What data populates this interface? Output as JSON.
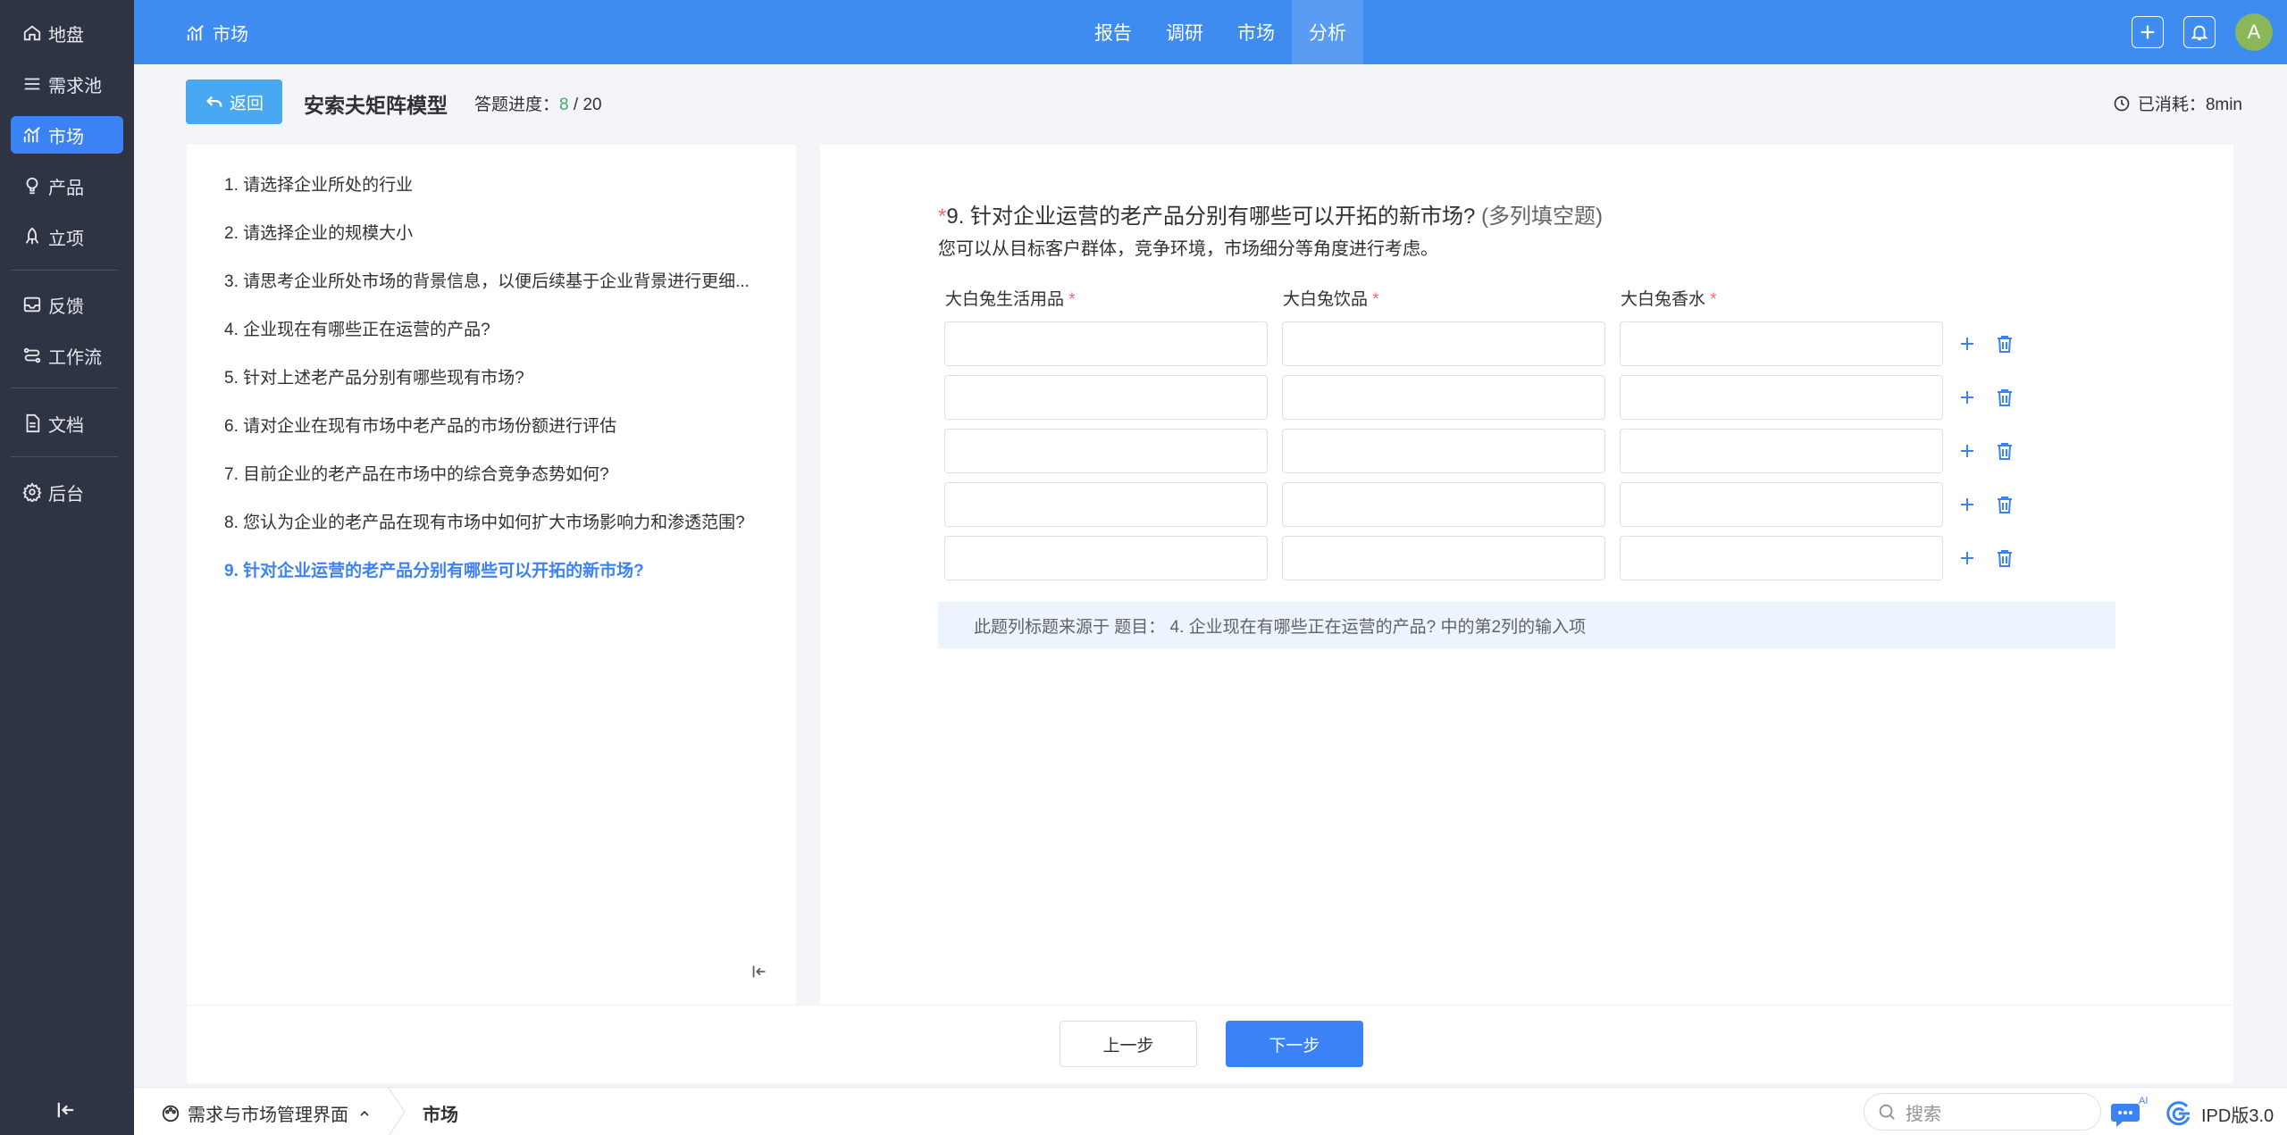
{
  "sidebar": {
    "items": [
      {
        "label": "地盘",
        "icon": "home-icon"
      },
      {
        "label": "需求池",
        "icon": "list-icon"
      },
      {
        "label": "市场",
        "icon": "chart-icon",
        "active": true
      },
      {
        "label": "产品",
        "icon": "bulb-icon"
      },
      {
        "label": "立项",
        "icon": "rocket-icon"
      },
      {
        "label": "反馈",
        "icon": "inbox-icon"
      },
      {
        "label": "工作流",
        "icon": "workflow-icon"
      },
      {
        "label": "文档",
        "icon": "document-icon"
      },
      {
        "label": "后台",
        "icon": "gear-icon"
      }
    ]
  },
  "header": {
    "title": "市场",
    "nav": [
      "报告",
      "调研",
      "市场",
      "分析"
    ],
    "active_nav": "分析",
    "avatar": "A"
  },
  "topbar": {
    "back_label": "返回",
    "title": "安索夫矩阵模型",
    "progress_label": "答题进度：",
    "progress_current": "8",
    "progress_sep": " / ",
    "progress_total": "20",
    "elapsed": "已消耗：8min"
  },
  "questions": [
    "1. 请选择企业所处的行业",
    "2. 请选择企业的规模大小",
    "3. 请思考企业所处市场的背景信息，以便后续基于企业背景进行更细...",
    "4. 企业现在有哪些正在运营的产品?",
    "5. 针对上述老产品分别有哪些现有市场?",
    "6. 请对企业在现有市场中老产品的市场份额进行评估",
    "7. 目前企业的老产品在市场中的综合竞争态势如何?",
    "8. 您认为企业的老产品在现有市场中如何扩大市场影响力和渗透范围?",
    "9. 针对企业运营的老产品分别有哪些可以开拓的新市场?"
  ],
  "current_question": {
    "required_mark": "*",
    "title": "9. 针对企业运营的老产品分别有哪些可以开拓的新市场?",
    "type": "(多列填空题)",
    "description": "您可以从目标客户群体，竞争环境，市场细分等角度进行考虑。",
    "columns": [
      "大白兔生活用品",
      "大白兔饮品",
      "大白兔香水"
    ],
    "rows": 5,
    "hint": "此题列标题来源于 题目： 4. 企业现在有哪些正在运营的产品?  中的第2列的输入项"
  },
  "footer": {
    "prev": "上一步",
    "next": "下一步"
  },
  "bottombar": {
    "crumb1": "需求与市场管理界面",
    "crumb2": "市场",
    "search_placeholder": "搜索",
    "brand": "IPD版3.0"
  },
  "colors": {
    "primary": "#3b82f6",
    "header": "#3f8cf0",
    "sidebar": "#2f3444",
    "required": "#f56c6c",
    "progress": "#3fae68"
  }
}
